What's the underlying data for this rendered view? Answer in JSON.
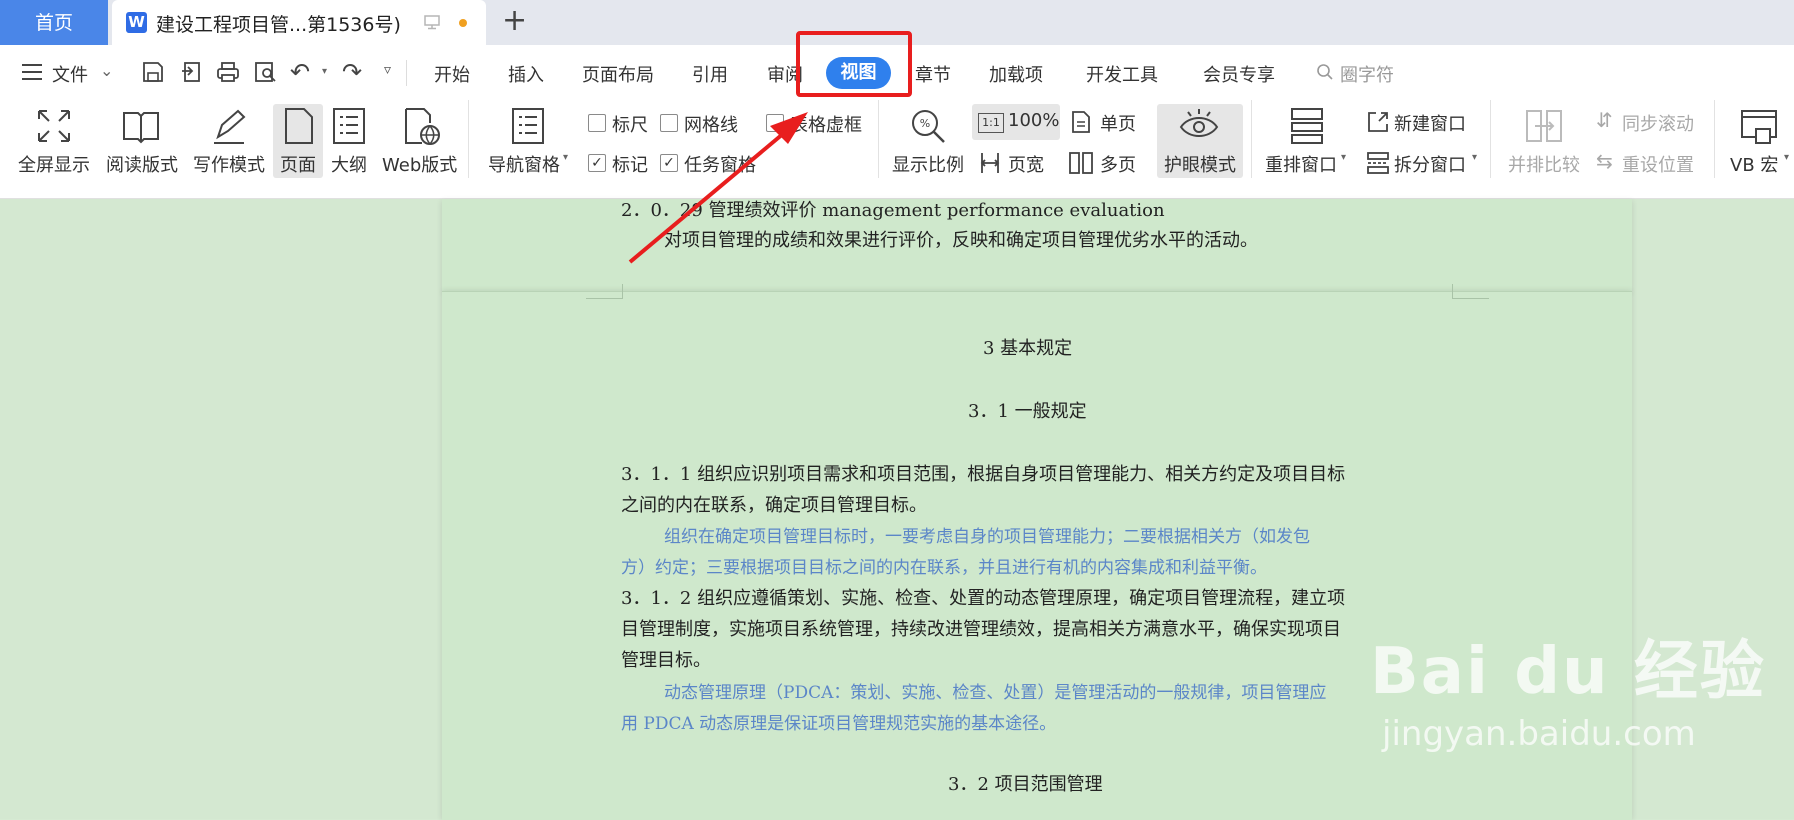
{
  "tabs": {
    "home": "首页",
    "doc_title": "建设工程项目管...第1536号)",
    "new_tab": "+"
  },
  "menu": {
    "file": "文件",
    "items": [
      "开始",
      "插入",
      "页面布局",
      "引用",
      "审阅",
      "视图",
      "章节",
      "加载项",
      "开发工具",
      "会员专享"
    ],
    "search": "圈字符"
  },
  "toolbar": {
    "fullscreen": "全屏显示",
    "reading": "阅读版式",
    "writing": "写作模式",
    "page": "页面",
    "outline": "大纲",
    "web": "Web版式",
    "nav_pane": "导航窗格",
    "ruler": "标尺",
    "gridlines": "网格线",
    "table_gridlines": "表格虚框",
    "marks": "标记",
    "task_pane": "任务窗格",
    "zoom": "显示比例",
    "zoom_value": "100%",
    "page_width": "页宽",
    "single_page": "单页",
    "multi_page": "多页",
    "eye_mode": "护眼模式",
    "rearrange": "重排窗口",
    "new_window": "新建窗口",
    "split_window": "拆分窗口",
    "side_by_side": "并排比较",
    "sync_scroll": "同步滚动",
    "reset_position": "重设位置",
    "vb_macro": "VB 宏"
  },
  "document": {
    "term_heading": "2．0．29 管理绩效评价 management performance evaluation",
    "term_text": "对项目管理的成绩和效果进行评价，反映和确定项目管理优劣水平的活动。",
    "chapter": "3  基本规定",
    "section": "3．1  一般规定",
    "clause1_line1": "3．1．1 组织应识别项目需求和项目范围，根据自身项目管理能力、相关方约定及项目目标",
    "clause1_line2": "之间的内在联系，确定项目管理目标。",
    "note1_line1": "组织在确定项目管理目标时，一要考虑自身的项目管理能力；二要根据相关方（如发包",
    "note1_line2": "方）约定；三要根据项目目标之间的内在联系，并且进行有机的内容集成和利益平衡。",
    "clause2_line1": "3．1．2 组织应遵循策划、实施、检查、处置的动态管理原理，确定项目管理流程，建立项",
    "clause2_line2": "目管理制度，实施项目系统管理，持续改进管理绩效，提高相关方满意水平，确保实现项目",
    "clause2_line3": "管理目标。",
    "note2_line1": "动态管理原理（PDCA：策划、实施、检查、处置）是管理活动的一般规律，项目管理应",
    "note2_line2": "用 PDCA 动态原理是保证项目管理规范实施的基本途径。",
    "section2": "3．2  项目范围管理"
  },
  "watermark": {
    "brand": "Bai du 经验",
    "url": "jingyan.baidu.com"
  },
  "colors": {
    "accent": "#2f80ed",
    "annotation": "#e81e1e",
    "page_bg": "#cfe8cc",
    "note_text": "#5b86c8"
  }
}
